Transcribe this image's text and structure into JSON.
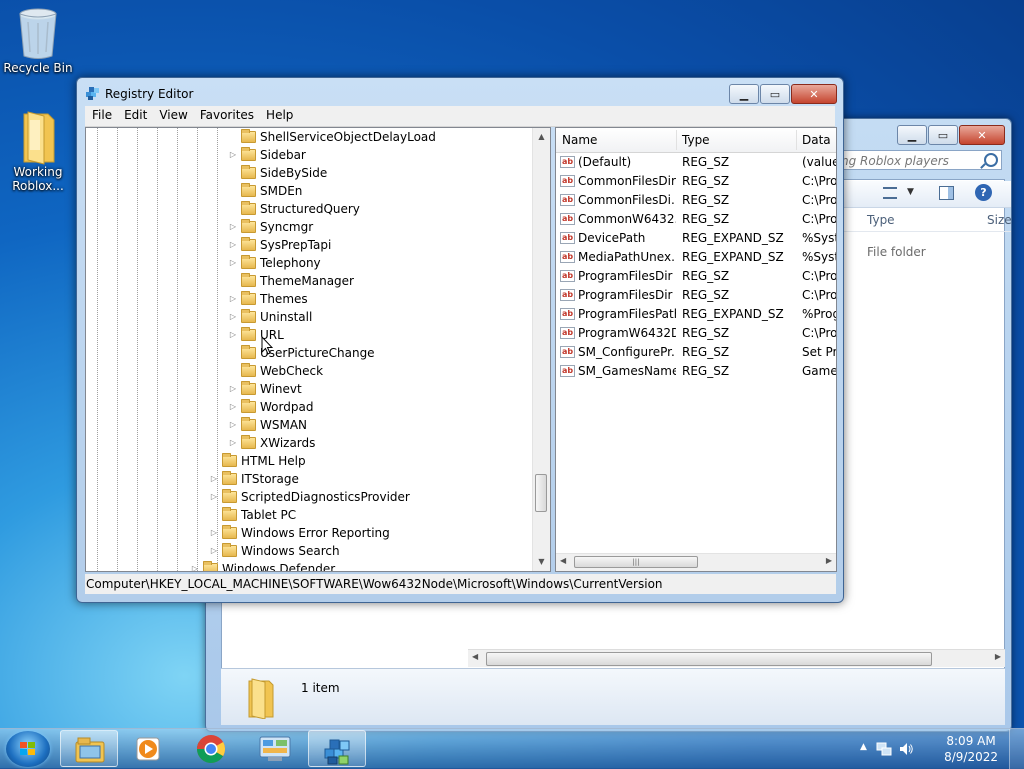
{
  "desktop": {
    "icons": [
      {
        "label": "Recycle Bin"
      },
      {
        "label": "Working Roblox..."
      }
    ]
  },
  "explorer": {
    "search_placeholder": "ng Roblox players",
    "columns": [
      "Type",
      "Size"
    ],
    "row_type": "File folder",
    "status_text": "1 item"
  },
  "regedit": {
    "title": "Registry Editor",
    "menu": [
      "File",
      "Edit",
      "View",
      "Favorites",
      "Help"
    ],
    "tree": [
      {
        "label": "ShellServiceObjectDelayLoad",
        "expander": false,
        "level": 2
      },
      {
        "label": "Sidebar",
        "expander": true,
        "level": 2
      },
      {
        "label": "SideBySide",
        "expander": false,
        "level": 2
      },
      {
        "label": "SMDEn",
        "expander": false,
        "level": 2
      },
      {
        "label": "StructuredQuery",
        "expander": false,
        "level": 2
      },
      {
        "label": "Syncmgr",
        "expander": true,
        "level": 2
      },
      {
        "label": "SysPrepTapi",
        "expander": true,
        "level": 2
      },
      {
        "label": "Telephony",
        "expander": true,
        "level": 2
      },
      {
        "label": "ThemeManager",
        "expander": false,
        "level": 2
      },
      {
        "label": "Themes",
        "expander": true,
        "level": 2
      },
      {
        "label": "Uninstall",
        "expander": true,
        "level": 2
      },
      {
        "label": "URL",
        "expander": true,
        "level": 2
      },
      {
        "label": "UserPictureChange",
        "expander": false,
        "level": 2
      },
      {
        "label": "WebCheck",
        "expander": false,
        "level": 2
      },
      {
        "label": "Winevt",
        "expander": true,
        "level": 2
      },
      {
        "label": "Wordpad",
        "expander": true,
        "level": 2
      },
      {
        "label": "WSMAN",
        "expander": true,
        "level": 2
      },
      {
        "label": "XWizards",
        "expander": true,
        "level": 2
      },
      {
        "label": "HTML Help",
        "expander": false,
        "level": 1
      },
      {
        "label": "ITStorage",
        "expander": true,
        "level": 1
      },
      {
        "label": "ScriptedDiagnosticsProvider",
        "expander": true,
        "level": 1
      },
      {
        "label": "Tablet PC",
        "expander": false,
        "level": 1
      },
      {
        "label": "Windows Error Reporting",
        "expander": true,
        "level": 1
      },
      {
        "label": "Windows Search",
        "expander": true,
        "level": 1
      },
      {
        "label": "Windows Defender",
        "expander": true,
        "level": 0
      }
    ],
    "columns": [
      "Name",
      "Type",
      "Data"
    ],
    "values": [
      {
        "name": "(Default)",
        "type": "REG_SZ",
        "data": "(value"
      },
      {
        "name": "CommonFilesDir",
        "type": "REG_SZ",
        "data": "C:\\Pro"
      },
      {
        "name": "CommonFilesDi...",
        "type": "REG_SZ",
        "data": "C:\\Pro"
      },
      {
        "name": "CommonW6432...",
        "type": "REG_SZ",
        "data": "C:\\Pro"
      },
      {
        "name": "DevicePath",
        "type": "REG_EXPAND_SZ",
        "data": "%Syst"
      },
      {
        "name": "MediaPathUnex...",
        "type": "REG_EXPAND_SZ",
        "data": "%Syst"
      },
      {
        "name": "ProgramFilesDir",
        "type": "REG_SZ",
        "data": "C:\\Pro"
      },
      {
        "name": "ProgramFilesDir ...",
        "type": "REG_SZ",
        "data": "C:\\Pro"
      },
      {
        "name": "ProgramFilesPath",
        "type": "REG_EXPAND_SZ",
        "data": "%Prog"
      },
      {
        "name": "ProgramW6432Dir",
        "type": "REG_SZ",
        "data": "C:\\Pro"
      },
      {
        "name": "SM_ConfigurePr...",
        "type": "REG_SZ",
        "data": "Set Pr"
      },
      {
        "name": "SM_GamesName",
        "type": "REG_SZ",
        "data": "Game"
      }
    ],
    "status_path": "Computer\\HKEY_LOCAL_MACHINE\\SOFTWARE\\Wow6432Node\\Microsoft\\Windows\\CurrentVersion"
  },
  "taskbar": {
    "apps": [
      "windows-explorer",
      "media-player",
      "chrome",
      "control-panel",
      "registry-editor"
    ],
    "active": "registry-editor",
    "time": "8:09 AM",
    "date": "8/9/2022"
  }
}
